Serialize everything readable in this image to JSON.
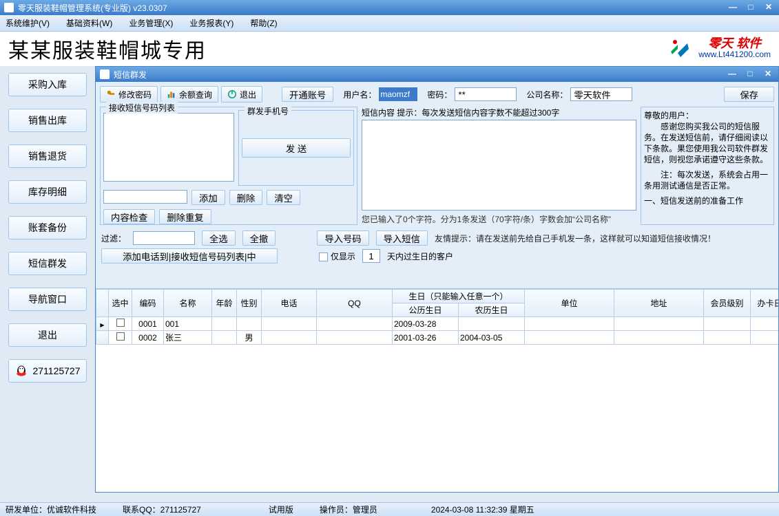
{
  "app_title": "零天服装鞋帽管理系统(专业版)  v23.0307",
  "menu": {
    "m1": "系统维护(V)",
    "m2": "基础资料(W)",
    "m3": "业务管理(X)",
    "m4": "业务报表(Y)",
    "m5": "帮助(Z)"
  },
  "banner_title": "某某服装鞋帽城专用",
  "logo": {
    "top": "零天 软件",
    "bot": "www.Lt441200.com"
  },
  "sidebar": {
    "items": [
      {
        "label": "采购入库"
      },
      {
        "label": "销售出库"
      },
      {
        "label": "销售退货"
      },
      {
        "label": "库存明细"
      },
      {
        "label": "账套备份"
      },
      {
        "label": "短信群发"
      },
      {
        "label": "导航窗口"
      },
      {
        "label": "退出"
      }
    ],
    "qq": "271125727"
  },
  "sub": {
    "title": "短信群发",
    "toolbar": {
      "pwd": "修改密码",
      "bal": "余额查询",
      "exit": "退出",
      "open": "开通账号",
      "user_lbl": "用户名：",
      "user_val": "maomzf",
      "pwd_lbl": "密码：",
      "pwd_val": "**",
      "comp_lbl": "公司名称：",
      "comp_val": "零天软件",
      "save": "保存"
    },
    "left": {
      "legend": "接收短信号码列表",
      "group_title": "群发手机号",
      "send_btn": "发 送",
      "add": "添加",
      "del": "删除",
      "clear": "清空",
      "check": "内容检查",
      "dedup": "删除重复"
    },
    "mid": {
      "hint": "短信内容 提示：每次发送短信内容字数不能超过300字",
      "status": "您已输入了0个字符。分为1条发送（70字符/条）字数会加“公司名称”"
    },
    "right": {
      "title": "尊敬的用户：",
      "p1": "　　感谢您购买我公司的短信服务。在发送短信前，请仔细阅读以下条款。果您使用我公司软件群发短信，则视您承诺遵守这些条款。",
      "p2": "　　注：每次发送，系统会占用一条用测试通信是否正常。",
      "p3": "一、短信发送前的准备工作"
    },
    "filter": {
      "filter_lbl": "过滤：",
      "all": "全选",
      "none": "全撤",
      "imp_num": "导入号码",
      "imp_sms": "导入短信",
      "tip": "友情提示：请在发送前先给自己手机发一条，这样就可以知道短信接收情况！",
      "add_phone": "添加电话到|接收短信号码列表|中",
      "chk_lbl": "仅显示",
      "days": "1",
      "chk_suf": "天内过生日的客户"
    },
    "cols": {
      "sel": "选中",
      "code": "编码",
      "name": "名称",
      "age": "年龄",
      "sex": "性别",
      "phone": "电话",
      "qq": "QQ",
      "bday_group": "生日（只能输入任意一个）",
      "bday_solar": "公历生日",
      "bday_lunar": "农历生日",
      "unit": "单位",
      "addr": "地址",
      "level": "会员级别",
      "card_date": "办卡日期"
    },
    "rows": [
      {
        "code": "0001",
        "name": "001",
        "age": "",
        "sex": "",
        "phone": "",
        "qq": "",
        "bsolar": "2009-03-28",
        "blunar": "",
        "unit": "",
        "addr": "",
        "level": "",
        "card": ""
      },
      {
        "code": "0002",
        "name": "张三",
        "age": "",
        "sex": "男",
        "phone": "",
        "qq": "",
        "bsolar": "2001-03-26",
        "blunar": "2004-03-05",
        "unit": "",
        "addr": "",
        "level": "",
        "card": ""
      }
    ]
  },
  "status": {
    "dev": "研发单位：优诚软件科技",
    "contact": "联系QQ：271125727",
    "ver": "试用版",
    "op": "操作员：管理员",
    "dt": "2024-03-08 11:32:39 星期五"
  }
}
